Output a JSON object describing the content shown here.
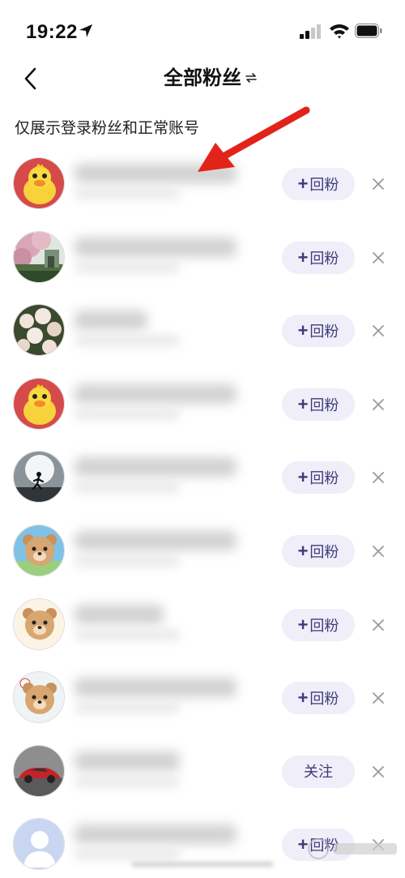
{
  "status_bar": {
    "time": "19:22"
  },
  "header": {
    "title": "全部粉丝"
  },
  "notice": "仅展示登录粉丝和正常账号",
  "fans": [
    {
      "avatar": "yellow-duck",
      "action": "回粉",
      "action_type": "follow-back"
    },
    {
      "avatar": "flowers-tree",
      "action": "回粉",
      "action_type": "follow-back"
    },
    {
      "avatar": "rose-bush",
      "action": "回粉",
      "action_type": "follow-back"
    },
    {
      "avatar": "yellow-duck",
      "action": "回粉",
      "action_type": "follow-back"
    },
    {
      "avatar": "runner-silhouette",
      "action": "回粉",
      "action_type": "follow-back"
    },
    {
      "avatar": "cartoon-bear",
      "action": "回粉",
      "action_type": "follow-back"
    },
    {
      "avatar": "cartoon-bear",
      "action": "回粉",
      "action_type": "follow-back"
    },
    {
      "avatar": "cartoon-bear",
      "action": "回粉",
      "action_type": "follow-back"
    },
    {
      "avatar": "red-sports-car",
      "action": "关注",
      "action_type": "follow"
    },
    {
      "avatar": "default-person",
      "action": "回粉",
      "action_type": "follow-back"
    }
  ],
  "colors": {
    "button_bg": "#efeef9",
    "button_text": "#3f3a78",
    "arrow": "#e2231a"
  }
}
